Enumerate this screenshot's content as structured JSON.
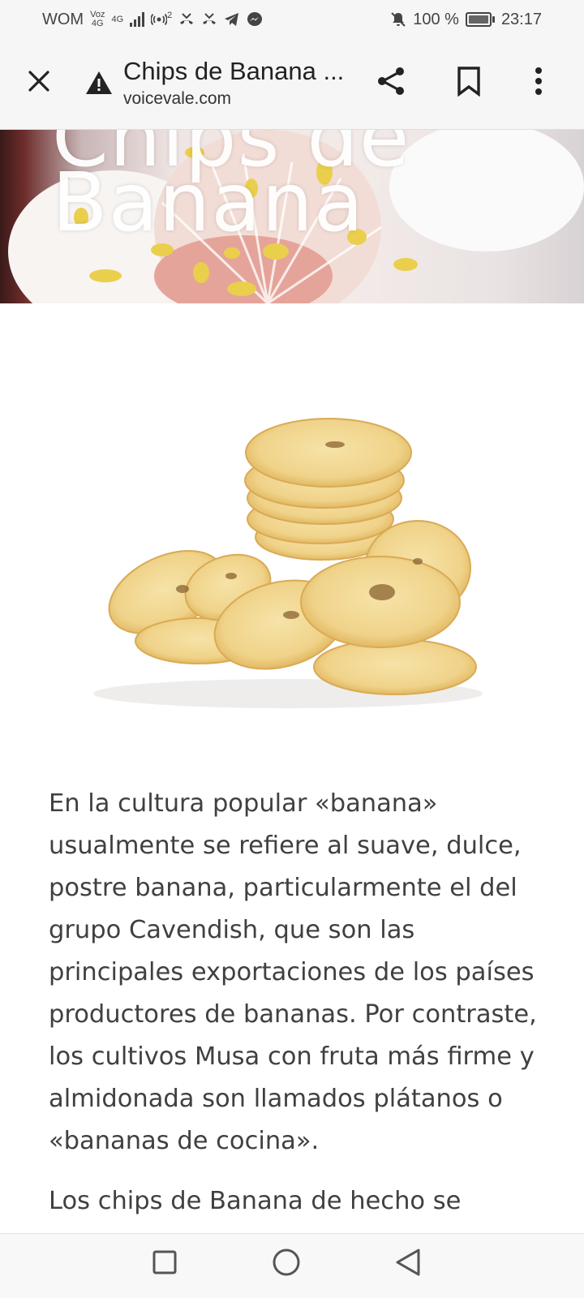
{
  "status_bar": {
    "carrier": "WOM",
    "volte_top": "Voz",
    "volte_bottom": "4G",
    "network_type": "4G",
    "hotspot_count": "2",
    "battery_percent": "100 %",
    "time": "23:17",
    "icons": [
      "signal-bars-icon",
      "hotspot-icon",
      "missed-call-icon",
      "missed-call-icon",
      "telegram-icon",
      "messenger-icon",
      "bell-muted-icon",
      "battery-icon"
    ]
  },
  "app_bar": {
    "page_title": "Chips de Banana ...",
    "domain": "voicevale.com",
    "icons": [
      "close-icon",
      "warning-icon",
      "share-icon",
      "bookmark-icon",
      "more-vert-icon"
    ]
  },
  "hero": {
    "title_line1": "Chips de",
    "title_line2": "Banana"
  },
  "article": {
    "paragraph1": "En la cultura popular «banana» usualmente se refiere al suave, dulce, postre banana, particularmente el del grupo Cavendish, que son las principales exportaciones de los países productores de bananas. Por contraste, los cultivos Musa con fruta más firme y almidonada son llamados plátanos o «bananas de cocina».",
    "paragraph2_start": "Los chips de Banana de hecho se"
  },
  "nav_bar": {
    "icons": [
      "recents-square-icon",
      "home-circle-icon",
      "back-triangle-icon"
    ]
  },
  "colors": {
    "chrome_background": "#f6f6f6",
    "text_body": "#404040",
    "chip_yellow": "#f1d58f"
  }
}
